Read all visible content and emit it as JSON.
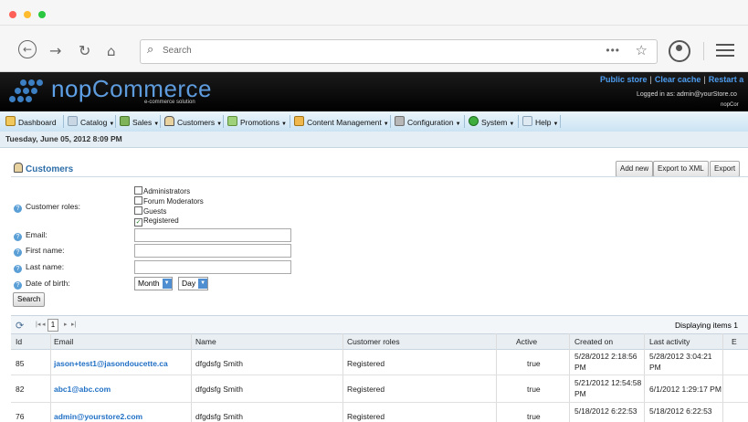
{
  "browser": {
    "traffic_colors": [
      "#fe5f57",
      "#febc2e",
      "#29c840"
    ],
    "back_icon": "back-icon",
    "forward_icon": "forward-icon",
    "reload_icon": "reload-icon",
    "home_icon": "home-icon",
    "search_placeholder": "Search",
    "more_icon": "more-icon",
    "bookmark_icon": "star-icon",
    "account_icon": "account-icon",
    "menu_icon": "hamburger-menu-icon"
  },
  "header": {
    "logo_prefix": "nop",
    "logo_suffix": "Commerce",
    "logo_sub": "e-commerce solution",
    "links": [
      "Public store",
      "Clear cache",
      "Restart a"
    ],
    "logged_in": "Logged in as: admin@yourStore.co",
    "nopco": "nopCor"
  },
  "menu": {
    "items": [
      {
        "label": "Dashboard",
        "icon": "dashboard-icon",
        "has_dropdown": false
      },
      {
        "label": "Catalog",
        "icon": "catalog-icon",
        "has_dropdown": true
      },
      {
        "label": "Sales",
        "icon": "sales-icon",
        "has_dropdown": true
      },
      {
        "label": "Customers",
        "icon": "customers-icon",
        "has_dropdown": true
      },
      {
        "label": "Promotions",
        "icon": "promotions-icon",
        "has_dropdown": true
      },
      {
        "label": "Content Management",
        "icon": "folder-icon",
        "has_dropdown": true
      },
      {
        "label": "Configuration",
        "icon": "wrench-icon",
        "has_dropdown": true
      },
      {
        "label": "System",
        "icon": "system-icon",
        "has_dropdown": true
      },
      {
        "label": "Help",
        "icon": "help-icon",
        "has_dropdown": true
      }
    ]
  },
  "date_text": "Tuesday, June 05, 2012 8:09 PM",
  "page": {
    "title": "Customers",
    "buttons": [
      "Add new",
      "Export to XML",
      "Export"
    ]
  },
  "filters": {
    "roles_label": "Customer roles:",
    "roles": [
      {
        "label": "Administrators",
        "checked": false
      },
      {
        "label": "Forum Moderators",
        "checked": false
      },
      {
        "label": "Guests",
        "checked": false
      },
      {
        "label": "Registered",
        "checked": true
      }
    ],
    "email_label": "Email:",
    "first_name_label": "First name:",
    "last_name_label": "Last name:",
    "dob_label": "Date of birth:",
    "month_value": "Month",
    "day_value": "Day",
    "search_label": "Search"
  },
  "grid": {
    "page_number": "1",
    "displaying": "Displaying items 1",
    "columns": [
      "Id",
      "Email",
      "Name",
      "Customer roles",
      "Active",
      "Created on",
      "Last activity",
      "E"
    ],
    "rows": [
      {
        "id": "85",
        "email": "jason+test1@jasondoucette.ca",
        "name": "dfgdsfg Smith",
        "roles": "Registered",
        "active": "true",
        "created": [
          "5/28/2012 2:18:56",
          "PM"
        ],
        "last": [
          "5/28/2012 3:04:21",
          "PM"
        ]
      },
      {
        "id": "82",
        "email": "abc1@abc.com",
        "name": "dfgdsfg Smith",
        "roles": "Registered",
        "active": "true",
        "created": [
          "5/21/2012 12:54:58",
          "PM"
        ],
        "last": [
          "6/1/2012 1:29:17 PM"
        ]
      },
      {
        "id": "76",
        "email": "admin@yourstore2.com",
        "name": "dfgdsfg Smith",
        "roles": "Registered",
        "active": "true",
        "created": [
          "5/18/2012 6:22:53"
        ],
        "last": [
          "5/18/2012 6:22:53"
        ]
      }
    ]
  }
}
